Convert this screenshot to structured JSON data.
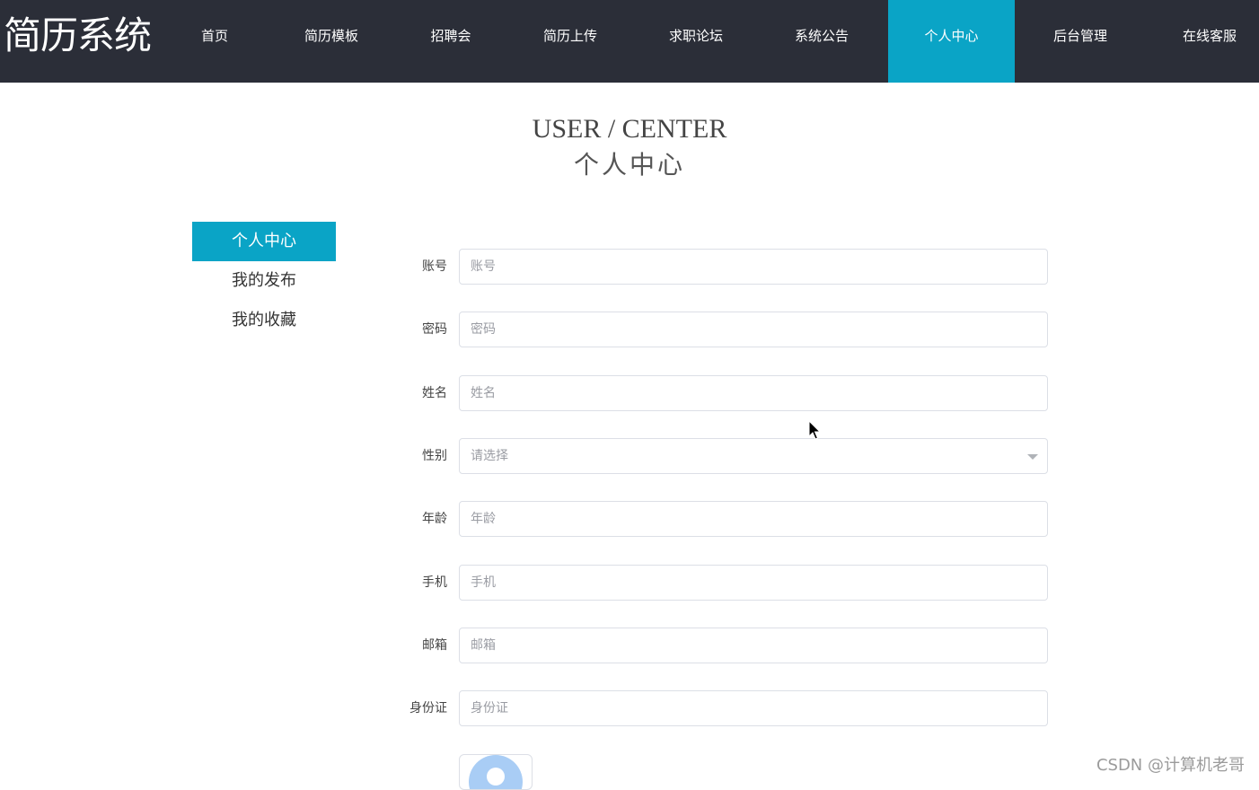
{
  "header": {
    "logo": "简历系统",
    "nav": [
      {
        "label": "首页"
      },
      {
        "label": "简历模板"
      },
      {
        "label": "招聘会"
      },
      {
        "label": "简历上传"
      },
      {
        "label": "求职论坛"
      },
      {
        "label": "系统公告"
      },
      {
        "label": "个人中心",
        "active": true
      },
      {
        "label": "后台管理"
      },
      {
        "label": "在线客服"
      }
    ]
  },
  "page": {
    "title_en": "USER / CENTER",
    "title_cn": "个人中心"
  },
  "sidebar": {
    "items": [
      {
        "label": "个人中心",
        "active": true
      },
      {
        "label": "我的发布"
      },
      {
        "label": "我的收藏"
      }
    ]
  },
  "form": {
    "account": {
      "label": "账号",
      "placeholder": "账号",
      "value": ""
    },
    "password": {
      "label": "密码",
      "placeholder": "密码",
      "value": ""
    },
    "name": {
      "label": "姓名",
      "placeholder": "姓名",
      "value": ""
    },
    "gender": {
      "label": "性别",
      "placeholder": "请选择",
      "value": ""
    },
    "age": {
      "label": "年龄",
      "placeholder": "年龄",
      "value": ""
    },
    "phone": {
      "label": "手机",
      "placeholder": "手机",
      "value": ""
    },
    "email": {
      "label": "邮箱",
      "placeholder": "邮箱",
      "value": ""
    },
    "id_card": {
      "label": "身份证",
      "placeholder": "身份证",
      "value": ""
    }
  },
  "watermark": "CSDN @计算机老哥",
  "colors": {
    "header_bg": "#2b2e38",
    "accent": "#0aa4c6",
    "avatar": "#a9cdf5"
  }
}
